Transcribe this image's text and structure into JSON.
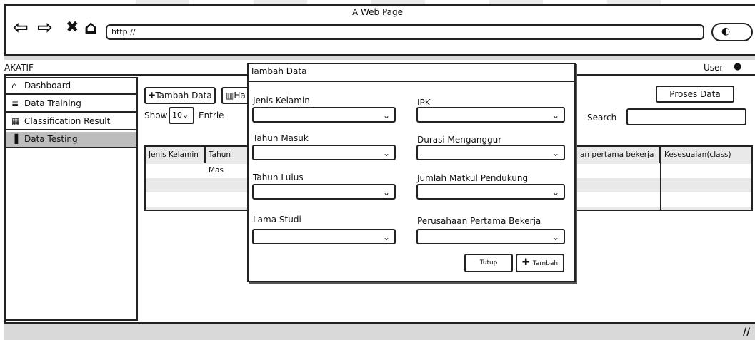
{
  "browser": {
    "window_title": "A Web Page",
    "url": "http://",
    "nav": {
      "back_icon": "⇦",
      "forward_icon": "⇨",
      "stop_icon": "✖",
      "home_icon": "⌂"
    },
    "search_icon": "🔍"
  },
  "app": {
    "name": "AKATIF",
    "user": "User"
  },
  "sidebar": {
    "items": [
      {
        "label": "Dashboard",
        "icon": "home-icon"
      },
      {
        "label": "Data Training",
        "icon": "database-icon"
      },
      {
        "label": "Classification Result",
        "icon": "table-icon"
      },
      {
        "label": "Data Testing",
        "icon": "file-icon"
      }
    ],
    "active": "Data Testing"
  },
  "main": {
    "add_button": "Tambah Data",
    "delete_button": "Ha",
    "process_button": "Proses Data",
    "show_label": "Show",
    "entries_value": "10",
    "entries_label": "Entrie",
    "search_label": "Search",
    "table_headers": [
      "Jenis Kelamin",
      "Tahun Mas",
      "an pertama bekerja",
      "Kesesuaian(class)"
    ]
  },
  "modal": {
    "title": "Tambah Data",
    "fields_left": [
      "Jenis Kelamin",
      "Tahun Masuk",
      "Tahun Lulus",
      "Lama Studi"
    ],
    "fields_right": [
      "IPK",
      "Durasi Menganggur",
      "Jumlah Matkul Pendukung",
      "Perusahaan Pertama Bekerja"
    ],
    "close_button": "Tutup",
    "submit_button": "Tambah"
  }
}
